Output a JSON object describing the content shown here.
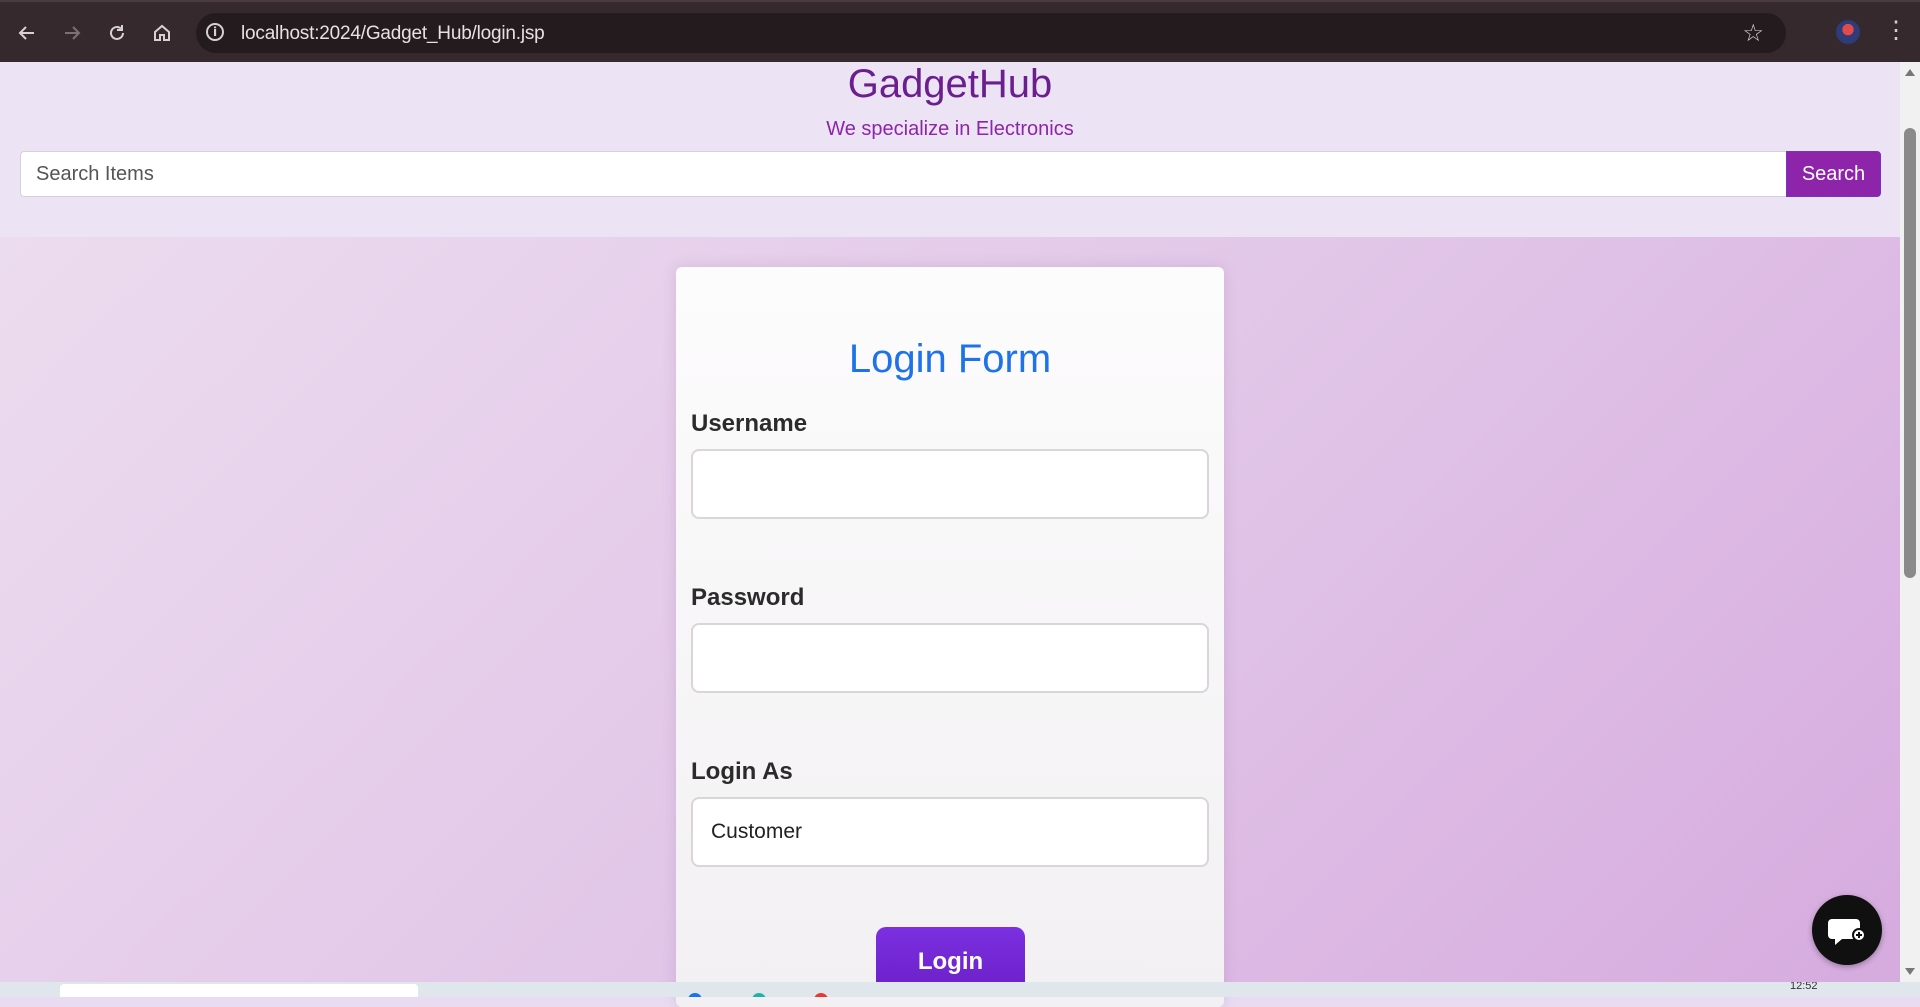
{
  "browser": {
    "url": "localhost:2024/Gadget_Hub/login.jsp"
  },
  "header": {
    "brand": "GadgetHub",
    "tagline": "We specialize in Electronics",
    "search_placeholder": "Search Items",
    "search_button": "Search"
  },
  "login_form": {
    "title": "Login Form",
    "username_label": "Username",
    "username_value": "",
    "password_label": "Password",
    "password_value": "",
    "role_label": "Login As",
    "role_value": "Customer",
    "submit_label": "Login"
  },
  "taskbar": {
    "clock": "12:52"
  },
  "colors": {
    "brand": "#6b1f8f",
    "accent": "#8e24aa",
    "form_title": "#1e73e8",
    "login_button": "#7b2fe0"
  },
  "icons": [
    "back-arrow-icon",
    "forward-arrow-icon",
    "reload-icon",
    "home-icon",
    "site-info-icon",
    "bookmark-star-icon",
    "profile-avatar-icon",
    "kebab-menu-icon",
    "chat-icon"
  ]
}
